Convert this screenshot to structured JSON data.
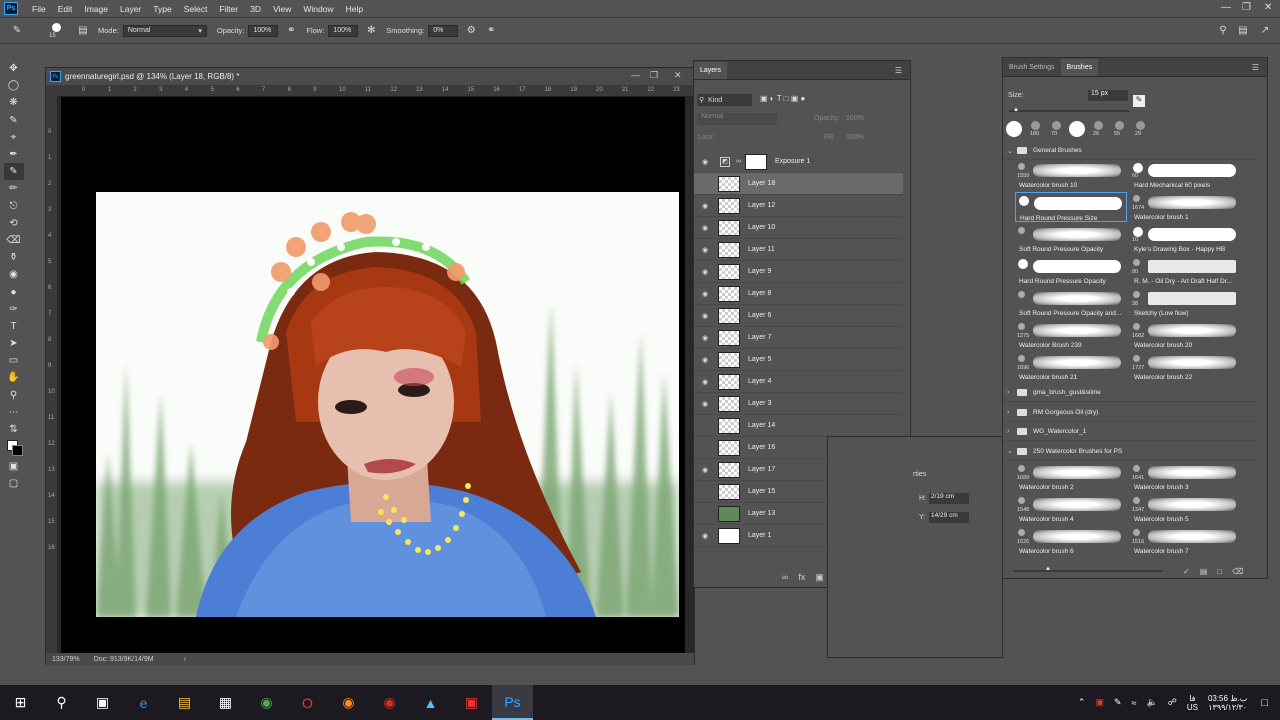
{
  "menu": {
    "app_logo": "Ps",
    "items": [
      "File",
      "Edit",
      "Image",
      "Layer",
      "Type",
      "Select",
      "Filter",
      "3D",
      "View",
      "Window",
      "Help"
    ]
  },
  "options_bar": {
    "brush_size": "15",
    "mode_label": "Mode:",
    "mode_value": "Normal",
    "opacity_label": "Opacity:",
    "opacity_value": "100%",
    "flow_label": "Flow:",
    "flow_value": "100%",
    "smoothing_label": "Smoothing:",
    "smoothing_value": "0%"
  },
  "document": {
    "ps_mini": "Ps",
    "title": "greennaturegirl.psd @ 134% (Layer 18, RGB/8) *",
    "ruler_ticks": [
      "0",
      "1",
      "2",
      "3",
      "4",
      "5",
      "6",
      "7",
      "8",
      "9",
      "10",
      "11",
      "12",
      "13",
      "14",
      "15",
      "16",
      "17",
      "18",
      "19",
      "20",
      "21",
      "22",
      "23"
    ],
    "ruler_v_ticks": [
      "0",
      "1",
      "2",
      "3",
      "4",
      "5",
      "6",
      "7",
      "8",
      "9",
      "10",
      "11",
      "12",
      "13",
      "14",
      "15",
      "16"
    ],
    "zoom": "133/79%",
    "doc_info": "Doc: 913/9K/14/9M"
  },
  "layers_panel": {
    "tab": "Layers",
    "filter_kind": "Kind",
    "blend_mode": "Normal",
    "opacity_label": "Opacity:",
    "opacity_value": "100%",
    "lock_label": "Lock:",
    "fill_label": "Fill:",
    "fill_value": "100%",
    "layers": [
      {
        "name": "Exposure 1",
        "visible": true,
        "thumb": "adjustment"
      },
      {
        "name": "Layer 18",
        "visible": false,
        "thumb": "checker",
        "selected": true
      },
      {
        "name": "Layer 12",
        "visible": true,
        "thumb": "checker"
      },
      {
        "name": "Layer 10",
        "visible": true,
        "thumb": "checker"
      },
      {
        "name": "Layer 11",
        "visible": true,
        "thumb": "checker"
      },
      {
        "name": "Layer 9",
        "visible": true,
        "thumb": "checker"
      },
      {
        "name": "Layer 8",
        "visible": true,
        "thumb": "checker"
      },
      {
        "name": "Layer 6",
        "visible": true,
        "thumb": "checker"
      },
      {
        "name": "Layer 7",
        "visible": true,
        "thumb": "checker"
      },
      {
        "name": "Layer 5",
        "visible": true,
        "thumb": "checker"
      },
      {
        "name": "Layer 4",
        "visible": true,
        "thumb": "checker"
      },
      {
        "name": "Layer 3",
        "visible": true,
        "thumb": "checker"
      },
      {
        "name": "Layer 14",
        "visible": false,
        "thumb": "checker"
      },
      {
        "name": "Layer 16",
        "visible": false,
        "thumb": "checker"
      },
      {
        "name": "Layer 17",
        "visible": true,
        "thumb": "checker"
      },
      {
        "name": "Layer 15",
        "visible": false,
        "thumb": "checker"
      },
      {
        "name": "Layer 13",
        "visible": false,
        "thumb": "green"
      },
      {
        "name": "Layer 1",
        "visible": true,
        "thumb": "white"
      }
    ]
  },
  "properties_panel": {
    "title_fragment": "rties",
    "h_label": "H:",
    "h_value": "2/19 cm",
    "y_label": "Y:",
    "y_value": "14/29 cm"
  },
  "brushes_panel": {
    "tabs": [
      "Brush Settings",
      "Brushes"
    ],
    "size_label": "Size:",
    "size_value": "15 px",
    "recent_sizes": [
      "180",
      "70",
      "26",
      "55",
      "29"
    ],
    "general_folder": "General Brushes",
    "brushes": [
      {
        "num": "1559",
        "name": "Watercolor brush 10",
        "style": "soft"
      },
      {
        "num": "60",
        "name": "Hard Mechanical 60 pixels",
        "style": "hard"
      },
      {
        "num": "",
        "name": "Hard Round Pressure Size",
        "style": "hard",
        "selected": true
      },
      {
        "num": "1674",
        "name": "Watercolor brush 1",
        "style": "soft"
      },
      {
        "num": "",
        "name": "Soft Round Pressure Opacity",
        "style": "soft"
      },
      {
        "num": "10",
        "name": "Kyle's Drawing Box - Happy HB",
        "style": "hard"
      },
      {
        "num": "",
        "name": "Hard Round Pressure Opacity",
        "style": "hard"
      },
      {
        "num": "80",
        "name": "R. M. - Oil Dry - Art Draft Half Dr...",
        "style": "rough"
      },
      {
        "num": "",
        "name": "Soft Round Pressure Opacity and...",
        "style": "soft"
      },
      {
        "num": "38",
        "name": "Sketchy (Low flow)",
        "style": "rough"
      },
      {
        "num": "1275",
        "name": "Watercolor Brush 239",
        "style": "soft"
      },
      {
        "num": "1682",
        "name": "Watercolor brush 20",
        "style": "soft"
      },
      {
        "num": "1696",
        "name": "Watercolor brush 21",
        "style": "soft"
      },
      {
        "num": "1727",
        "name": "Watercolor brush 22",
        "style": "soft"
      }
    ],
    "folders": [
      "gma_brush_gust&slime",
      "RM Gorgeous Oil (dry)",
      "WG_Watercolor_1",
      "250 Watercolor Brushes for PS"
    ],
    "brushes2": [
      {
        "num": "1689",
        "name": "Watercolor brush 2"
      },
      {
        "num": "1641",
        "name": "Watercolor brush 3"
      },
      {
        "num": "1548",
        "name": "Watercolor brush 4"
      },
      {
        "num": "1347",
        "name": "Watercolor brush 5"
      },
      {
        "num": "1526",
        "name": "Watercolor brush 6"
      },
      {
        "num": "1516",
        "name": "Watercolor brush 7"
      }
    ]
  },
  "taskbar": {
    "tray_lang_top": "فا",
    "tray_lang_bottom": "US",
    "time": "03:56 ب.ظ",
    "date": "۱۳۹۹/۱۲/۳۰"
  },
  "colors": {
    "accent": "#31a8ff",
    "canvas_bg": "#000000",
    "panel_bg": "#535353"
  }
}
